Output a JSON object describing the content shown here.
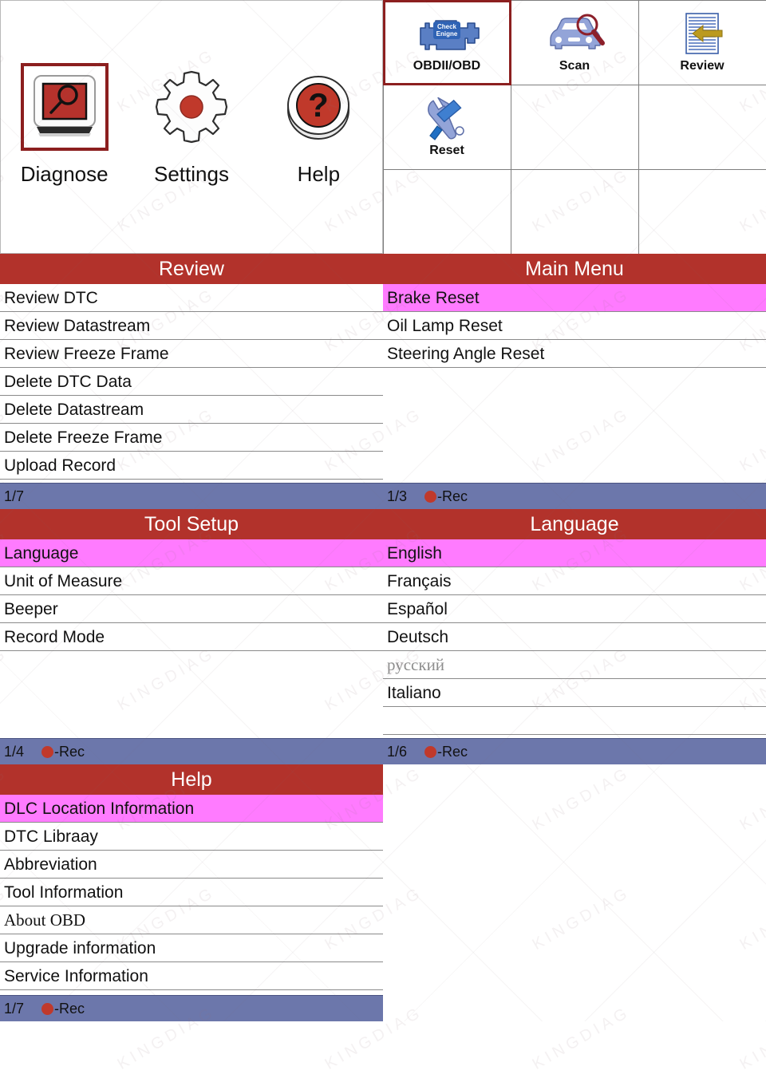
{
  "home": {
    "items": [
      {
        "label": "Diagnose",
        "icon": "magnifier-screen-icon",
        "selected": true
      },
      {
        "label": "Settings",
        "icon": "gear-icon",
        "selected": false
      },
      {
        "label": "Help",
        "icon": "question-mark-button-icon",
        "selected": false
      }
    ]
  },
  "function_grid": {
    "cells": [
      {
        "label": "OBDII/OBD",
        "icon": "check-engine-icon",
        "icon_text_line1": "Check",
        "icon_text_line2": "Enigne",
        "selected": true
      },
      {
        "label": "Scan",
        "icon": "car-magnifier-icon",
        "selected": false
      },
      {
        "label": "Review",
        "icon": "document-arrow-icon",
        "selected": false
      },
      {
        "label": "Reset",
        "icon": "wrench-screwdriver-icon",
        "selected": false
      },
      {
        "label": "",
        "icon": "",
        "selected": false
      },
      {
        "label": "",
        "icon": "",
        "selected": false
      },
      {
        "label": "",
        "icon": "",
        "selected": false
      },
      {
        "label": "",
        "icon": "",
        "selected": false
      },
      {
        "label": "",
        "icon": "",
        "selected": false
      }
    ]
  },
  "panels": {
    "review": {
      "title": "Review",
      "items": [
        {
          "label": "Review DTC",
          "selected": false
        },
        {
          "label": "Review Datastream",
          "selected": false
        },
        {
          "label": "Review Freeze Frame",
          "selected": false
        },
        {
          "label": "Delete DTC Data",
          "selected": false
        },
        {
          "label": "Delete Datastream",
          "selected": false
        },
        {
          "label": "Delete Freeze Frame",
          "selected": false
        },
        {
          "label": "Upload Record",
          "selected": false
        }
      ],
      "status": {
        "page": "1/7",
        "rec_label": "-Rec",
        "show_rec": false
      }
    },
    "main_menu": {
      "title": "Main Menu",
      "items": [
        {
          "label": "Brake Reset",
          "selected": true
        },
        {
          "label": "Oil Lamp Reset",
          "selected": false
        },
        {
          "label": "Steering Angle Reset",
          "selected": false
        }
      ],
      "status": {
        "page": "1/3",
        "rec_label": "-Rec",
        "show_rec": true
      }
    },
    "tool_setup": {
      "title": "Tool Setup",
      "items": [
        {
          "label": "Language",
          "selected": true
        },
        {
          "label": "Unit of Measure",
          "selected": false
        },
        {
          "label": "Beeper",
          "selected": false
        },
        {
          "label": "Record Mode",
          "selected": false
        }
      ],
      "status": {
        "page": "1/4",
        "rec_label": "-Rec",
        "show_rec": true
      }
    },
    "language": {
      "title": "Language",
      "items": [
        {
          "label": "English",
          "selected": true
        },
        {
          "label": "Français",
          "selected": false
        },
        {
          "label": "Español",
          "selected": false
        },
        {
          "label": "Deutsch",
          "selected": false
        },
        {
          "label": "русский",
          "selected": false,
          "muted": true
        },
        {
          "label": "Italiano",
          "selected": false
        }
      ],
      "status": {
        "page": "1/6",
        "rec_label": "-Rec",
        "show_rec": true
      }
    },
    "help": {
      "title": "Help",
      "items": [
        {
          "label": "DLC Location Information",
          "selected": true
        },
        {
          "label": "DTC Libraay",
          "selected": false
        },
        {
          "label": "Abbreviation",
          "selected": false
        },
        {
          "label": "Tool Information",
          "selected": false
        },
        {
          "label": "About OBD",
          "selected": false,
          "serif": true
        },
        {
          "label": "Upgrade information",
          "selected": false
        },
        {
          "label": "Service Information",
          "selected": false
        }
      ],
      "status": {
        "page": "1/7",
        "rec_label": "-Rec",
        "show_rec": true
      }
    }
  },
  "watermark": {
    "text": "KINGDIAG"
  },
  "colors": {
    "title_bar": "#b2322b",
    "status_bar": "#6c77ab",
    "selected_row": "#ff7bff",
    "selection_border": "#8c1f1f",
    "rec_dot": "#c0392b"
  }
}
